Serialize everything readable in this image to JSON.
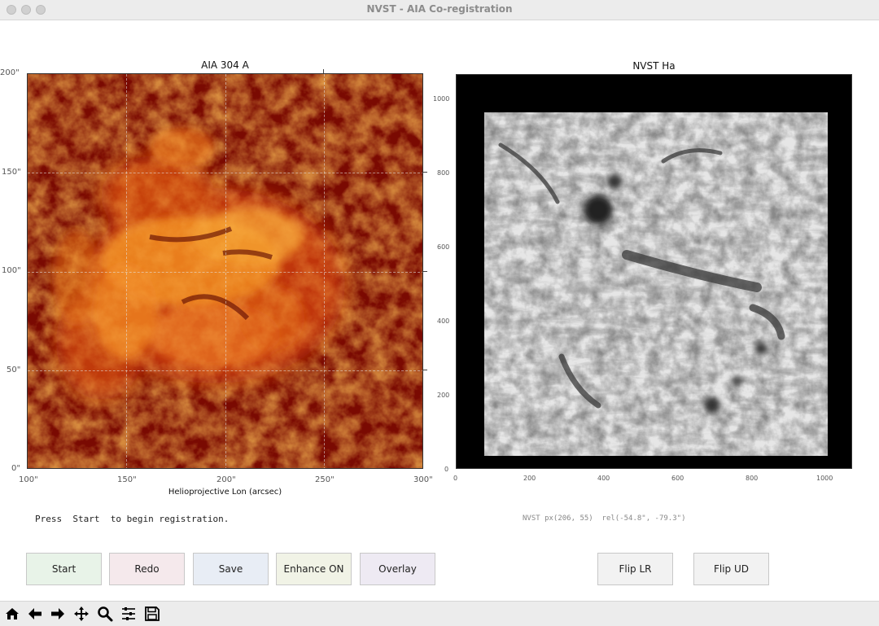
{
  "window": {
    "title": "NVST - AIA Co-registration"
  },
  "left_plot": {
    "title": "AIA 304 A",
    "xlabel": "Helioprojective Lon (arcsec)",
    "yticks": [
      "200\"",
      "150\"",
      "100\"",
      "50\"",
      "0\""
    ],
    "xticks": [
      "100\"",
      "150\"",
      "200\"",
      "250\"",
      "300\""
    ]
  },
  "right_plot": {
    "title": "NVST Ha",
    "yticks": [
      "1000",
      "800",
      "600",
      "400",
      "200",
      "0"
    ],
    "xticks": [
      "0",
      "200",
      "400",
      "600",
      "800",
      "1000"
    ]
  },
  "status": {
    "message": "Press  Start  to begin registration.",
    "coords": "NVST px(206, 55)  rel(-54.8\", -79.3\")"
  },
  "buttons": {
    "start": {
      "label": "Start",
      "color": "#e8f3e8"
    },
    "redo": {
      "label": "Redo",
      "color": "#f5e9ec"
    },
    "save": {
      "label": "Save",
      "color": "#e8edf5"
    },
    "enhance": {
      "label": "Enhance ON",
      "color": "#f1f3e6"
    },
    "overlay": {
      "label": "Overlay",
      "color": "#eeeaf3"
    },
    "flip_lr": {
      "label": "Flip LR",
      "color": "#f2f2f2"
    },
    "flip_ud": {
      "label": "Flip UD",
      "color": "#f2f2f2"
    }
  },
  "toolbar": {
    "icons": [
      "home-icon",
      "back-arrow-icon",
      "forward-arrow-icon",
      "pan-icon",
      "zoom-icon",
      "configure-subplots-icon",
      "save-figure-icon"
    ]
  }
}
